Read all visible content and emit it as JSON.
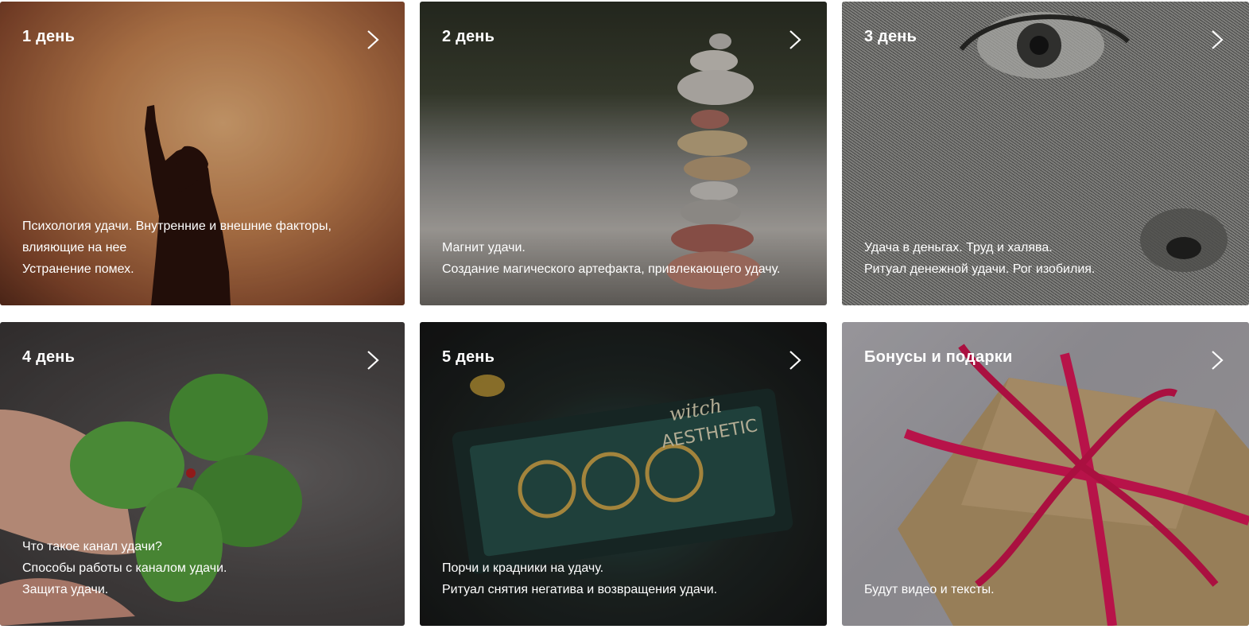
{
  "cards": [
    {
      "title": "1 день",
      "lines": [
        "Психология удачи. Внутренние и внешние факторы,",
        "влияющие на нее",
        "Устранение помех."
      ]
    },
    {
      "title": "2 день",
      "lines": [
        "Магнит удачи.",
        "Создание магического артефакта, привлекающего удачу."
      ]
    },
    {
      "title": "3 день",
      "lines": [
        "Удача в деньгах. Труд и халява.",
        "Ритуал денежной удачи. Рог изобилия."
      ]
    },
    {
      "title": "4 день",
      "lines": [
        "Что такое канал удачи?",
        "Способы работы с каналом удачи.",
        "Защита удачи."
      ]
    },
    {
      "title": "5 день",
      "lines": [
        "Порчи и крадники на удачу.",
        "Ритуал снятия негатива и возвращения удачи."
      ]
    },
    {
      "title": "Бонусы и подарки",
      "lines": [
        "Будут видео и тексты."
      ]
    }
  ],
  "decor": {
    "book_text_1": "witch",
    "book_text_2": "AESTHETIC"
  },
  "colors": {
    "text": "#ffffff",
    "ribbon": "#e0185a",
    "clover": "#4f9b3a"
  },
  "icons": {
    "arrow": "chevron-right-icon"
  }
}
